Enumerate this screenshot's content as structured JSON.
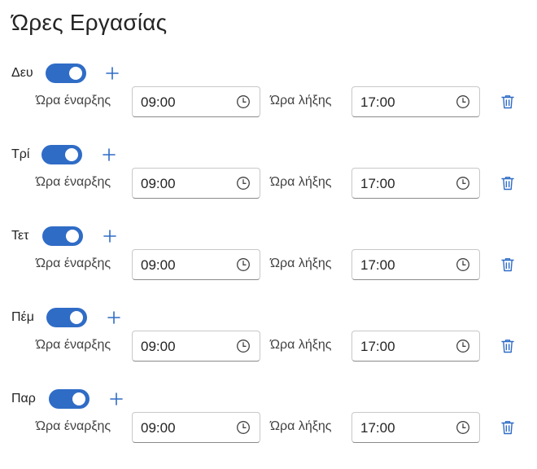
{
  "title": "Ώρες Εργασίας",
  "labels": {
    "start": "Ώρα έναρξης",
    "end": "Ώρα λήξης"
  },
  "accent_color": "#2f6cc6",
  "icons": {
    "add": "plus-icon",
    "time": "clock-icon",
    "delete": "trash-icon"
  },
  "days": [
    {
      "name": "Δευ",
      "enabled": true,
      "start": "09:00",
      "end": "17:00"
    },
    {
      "name": "Τρί",
      "enabled": true,
      "start": "09:00",
      "end": "17:00"
    },
    {
      "name": "Τετ",
      "enabled": true,
      "start": "09:00",
      "end": "17:00"
    },
    {
      "name": "Πέμ",
      "enabled": true,
      "start": "09:00",
      "end": "17:00"
    },
    {
      "name": "Παρ",
      "enabled": true,
      "start": "09:00",
      "end": "17:00"
    }
  ]
}
